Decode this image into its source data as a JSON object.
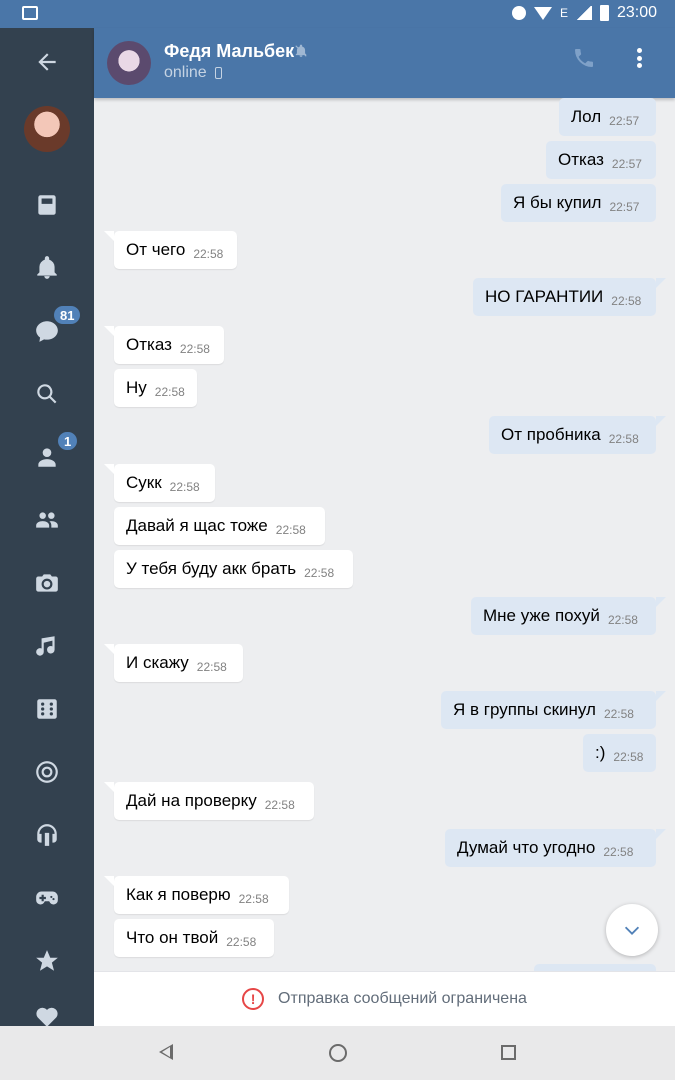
{
  "status_bar": {
    "time": "23:00",
    "network": "E"
  },
  "chat_header": {
    "name": "Федя Мальбек",
    "status": "online"
  },
  "sidebar": {
    "messages_badge": "81",
    "friends_badge": "1"
  },
  "messages": [
    {
      "dir": "out",
      "text": "Лол",
      "time": "22:57"
    },
    {
      "dir": "out",
      "text": "Отказ",
      "time": "22:57"
    },
    {
      "dir": "out",
      "text": "Я бы купил",
      "time": "22:57"
    },
    {
      "dir": "in",
      "text": "От чего",
      "time": "22:58"
    },
    {
      "dir": "out",
      "text": "НО ГАРАНТИИ",
      "time": "22:58"
    },
    {
      "dir": "in",
      "text": "Отказ",
      "time": "22:58"
    },
    {
      "dir": "in",
      "text": "Ну",
      "time": "22:58"
    },
    {
      "dir": "out",
      "text": "От пробника",
      "time": "22:58"
    },
    {
      "dir": "in",
      "text": "Сукк",
      "time": "22:58"
    },
    {
      "dir": "in",
      "text": "Давай я щас тоже",
      "time": "22:58"
    },
    {
      "dir": "in",
      "text": "У тебя буду акк брать",
      "time": "22:58"
    },
    {
      "dir": "out",
      "text": "Мне уже похуй",
      "time": "22:58"
    },
    {
      "dir": "in",
      "text": "И скажу",
      "time": "22:58"
    },
    {
      "dir": "out",
      "text": "Я в группы скинул",
      "time": "22:58"
    },
    {
      "dir": "out",
      "text": ":)",
      "time": "22:58"
    },
    {
      "dir": "in",
      "text": "Дай на проверку",
      "time": "22:58"
    },
    {
      "dir": "out",
      "text": "Думай что угодно",
      "time": "22:58"
    },
    {
      "dir": "in",
      "text": "Как я поверю",
      "time": "22:58"
    },
    {
      "dir": "in",
      "text": "Что он твой",
      "time": "22:58"
    }
  ],
  "restriction": {
    "text": "Отправка сообщений ограничена"
  },
  "colors": {
    "header": "#4a76a8",
    "sidebar": "#33414f",
    "outgoing": "#dde7f3",
    "incoming": "#ffffff",
    "warning": "#e64646"
  }
}
